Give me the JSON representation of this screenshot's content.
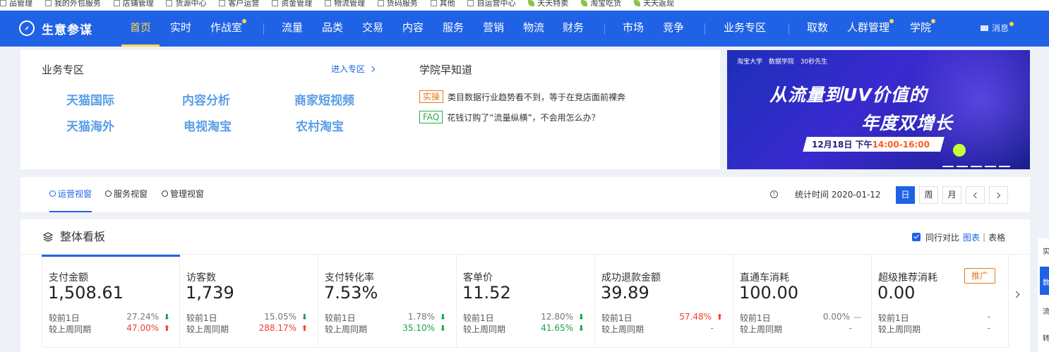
{
  "bookmarks": [
    "品管理",
    "我的外包服务",
    "店铺管理",
    "货源中心",
    "客户运营",
    "资金管理",
    "物流管理",
    "货码服务",
    "其他",
    "自运营中心",
    "天天特卖",
    "淘宝吃货",
    "天天返现"
  ],
  "nav": {
    "logo_text": "生意参谋",
    "items": [
      {
        "label": "首页"
      },
      {
        "label": "实时"
      },
      {
        "label": "作战室"
      },
      {
        "label": "流量"
      },
      {
        "label": "品类"
      },
      {
        "label": "交易"
      },
      {
        "label": "内容"
      },
      {
        "label": "服务"
      },
      {
        "label": "营销"
      },
      {
        "label": "物流"
      },
      {
        "label": "财务"
      },
      {
        "label": "市场"
      },
      {
        "label": "竞争"
      },
      {
        "label": "业务专区"
      },
      {
        "label": "取数"
      },
      {
        "label": "人群管理"
      },
      {
        "label": "学院"
      }
    ],
    "message_label": "消息"
  },
  "biz_zone": {
    "title": "业务专区",
    "enter_link": "进入专区",
    "links": [
      "天猫国际",
      "内容分析",
      "商家短视频",
      "天猫海外",
      "电视淘宝",
      "农村淘宝"
    ]
  },
  "academy": {
    "title": "学院早知道",
    "news": [
      {
        "tag": "实操",
        "text": "类目数据行业趋势看不到，等于在竞店面前裸奔"
      },
      {
        "tag": "FAQ",
        "text": "花钱订购了“流量纵横”，不会用怎么办？"
      }
    ]
  },
  "banner": {
    "logos": [
      "淘宝大学",
      "数据学院",
      "30秒先生"
    ],
    "line1": "从流量到UV价值的",
    "line2": "年度双增长",
    "date_text": "12月18日 下午",
    "time_text": "14:00-16:00"
  },
  "view_tabs": [
    "运营视窗",
    "服务视窗",
    "管理视窗"
  ],
  "stat_time_label": "统计时间 2020-01-12",
  "period_buttons": [
    "日",
    "周",
    "月"
  ],
  "board": {
    "title": "整体看板",
    "compare_label": "同行对比",
    "view_chart": "图表",
    "view_table": "表格",
    "promo_label": "推广",
    "row_labels": [
      "较前1日",
      "较上周同期"
    ],
    "metrics": [
      {
        "name": "支付金额",
        "value": "1,508.61",
        "d1": "27.24%",
        "d1_trend": "down",
        "w1": "47.00%",
        "w1_trend": "up"
      },
      {
        "name": "访客数",
        "value": "1,739",
        "d1": "15.05%",
        "d1_trend": "down",
        "w1": "288.17%",
        "w1_trend": "up"
      },
      {
        "name": "支付转化率",
        "value": "7.53%",
        "d1": "1.78%",
        "d1_trend": "down",
        "w1": "35.10%",
        "w1_trend": "down"
      },
      {
        "name": "客单价",
        "value": "11.52",
        "d1": "12.80%",
        "d1_trend": "down",
        "w1": "41.65%",
        "w1_trend": "down"
      },
      {
        "name": "成功退款金额",
        "value": "39.89",
        "d1": "57.48%",
        "d1_trend": "up",
        "w1": "-",
        "w1_trend": "none"
      },
      {
        "name": "直通车消耗",
        "value": "100.00",
        "d1": "0.00%",
        "d1_trend": "flat",
        "w1": "-",
        "w1_trend": "none"
      },
      {
        "name": "超级推荐消耗",
        "value": "0.00",
        "d1": "-",
        "d1_trend": "none",
        "w1": "-",
        "w1_trend": "none"
      }
    ]
  },
  "side_items": [
    "实",
    "数",
    "流",
    "转"
  ],
  "colors": {
    "primary": "#2062e6",
    "accent": "#ffd84d",
    "up": "#f23c31",
    "down": "#17a34a"
  }
}
